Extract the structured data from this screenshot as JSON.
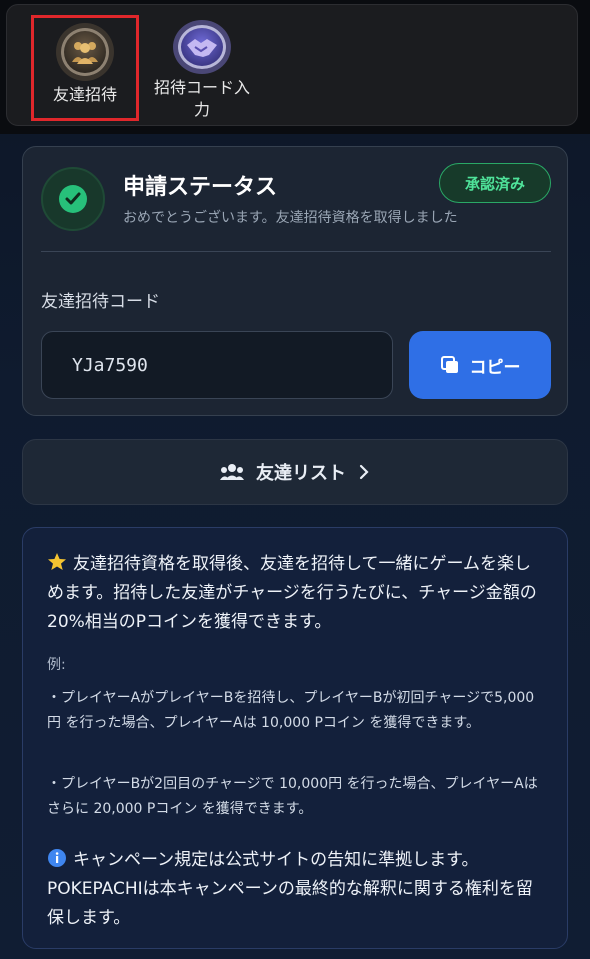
{
  "tabs": [
    {
      "label": "友達招待",
      "icon": "friends-group-icon",
      "selected": true
    },
    {
      "label": "招待コード入\n力",
      "icon": "handshake-icon",
      "selected": false
    }
  ],
  "status": {
    "title": "申請ステータス",
    "subtitle": "おめでとうございます。友達招待資格を取得しました",
    "badge": "承認済み",
    "badge_color": "#2aa866"
  },
  "invite": {
    "label": "友達招待コード",
    "code": "YJa7590",
    "copy_label": "コピー",
    "copy_color": "#2f6fe6"
  },
  "friend_list": {
    "label": "友達リスト"
  },
  "info": {
    "main_text": "友達招待資格を取得後、友達を招待して一緒にゲームを楽しめます。招待した友達がチャージを行うたびに、チャージ金額の20%相当のPコインを獲得できます。",
    "example_label": "例:",
    "bullet_1": "・プレイヤーAがプレイヤーBを招待し、プレイヤーBが初回チャージで5,000円 を行った場合、プレイヤーAは 10,000 Pコイン を獲得できます。",
    "bullet_2": "・プレイヤーBが2回目のチャージで 10,000円 を行った場合、プレイヤーAはさらに 20,000 Pコイン を獲得できます。",
    "notice": "キャンペーン規定は公式サイトの告知に準拠します。POKEPACHIは本キャンペーンの最終的な解釈に関する権利を留保します。"
  }
}
